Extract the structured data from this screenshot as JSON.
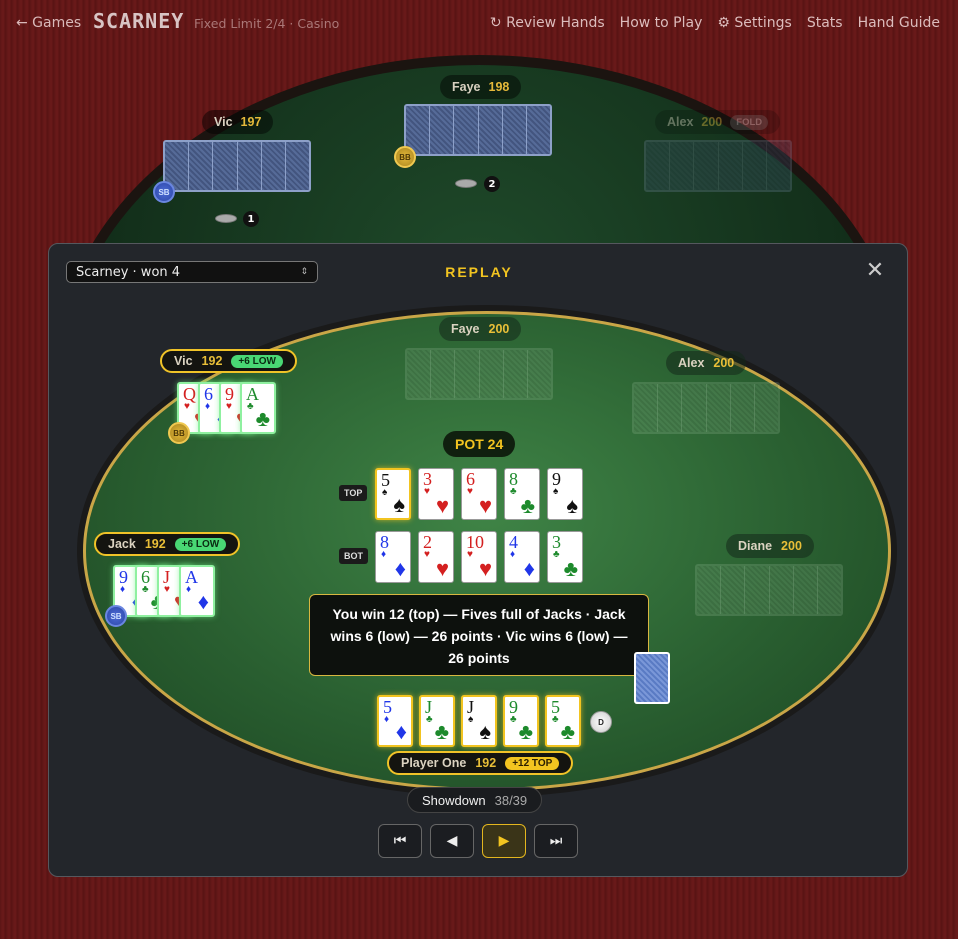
{
  "nav": {
    "back": "← Games",
    "brand": "SCARNEY",
    "subtitle": "Fixed Limit 2/4 · Casino",
    "links": [
      "↻ Review Hands",
      "How to Play",
      "⚙ Settings",
      "Stats",
      "Hand Guide"
    ]
  },
  "background_table": {
    "players": [
      {
        "name": "Vic",
        "stack": "197",
        "status": ""
      },
      {
        "name": "Faye",
        "stack": "198",
        "status": ""
      },
      {
        "name": "Alex",
        "stack": "200",
        "status": "FOLD"
      }
    ],
    "blinds": {
      "sb": "SB",
      "bb": "BB"
    },
    "bets": [
      "1",
      "2"
    ]
  },
  "replay": {
    "title": "REPLAY",
    "hand_select": "Scarney · won 4",
    "close": "✕",
    "pot": "POT 24",
    "row_labels": {
      "top": "TOP",
      "bot": "BOT"
    },
    "message": "You win 12 (top) — Fives full of Jacks · Jack wins 6 (low) — 26 points · Vic wins 6 (low) — 26 points",
    "status": {
      "label": "Showdown",
      "step": "38/39"
    },
    "controls": [
      "⏮",
      "◀",
      "▶",
      "⏭"
    ],
    "dealer": "D",
    "players": {
      "faye": {
        "name": "Faye",
        "stack": "200"
      },
      "alex": {
        "name": "Alex",
        "stack": "200"
      },
      "diane": {
        "name": "Diane",
        "stack": "200"
      },
      "vic": {
        "name": "Vic",
        "stack": "192",
        "delta": "+6 LOW",
        "blind": "BB"
      },
      "jack": {
        "name": "Jack",
        "stack": "192",
        "delta": "+6 LOW",
        "blind": "SB"
      },
      "hero": {
        "name": "Player One",
        "stack": "192",
        "delta": "+12 TOP"
      }
    },
    "cards": {
      "top": [
        {
          "rank": "5",
          "suit": "♠",
          "color": "black"
        },
        {
          "rank": "3",
          "suit": "♥",
          "color": "red"
        },
        {
          "rank": "6",
          "suit": "♥",
          "color": "red"
        },
        {
          "rank": "8",
          "suit": "♣",
          "color": "green"
        },
        {
          "rank": "9",
          "suit": "♠",
          "color": "black"
        }
      ],
      "bottom": [
        {
          "rank": "8",
          "suit": "♦",
          "color": "blue"
        },
        {
          "rank": "2",
          "suit": "♥",
          "color": "red"
        },
        {
          "rank": "10",
          "suit": "♥",
          "color": "red"
        },
        {
          "rank": "4",
          "suit": "♦",
          "color": "blue"
        },
        {
          "rank": "3",
          "suit": "♣",
          "color": "green"
        }
      ],
      "hero": [
        {
          "rank": "5",
          "suit": "♦",
          "color": "blue"
        },
        {
          "rank": "J",
          "suit": "♣",
          "color": "green"
        },
        {
          "rank": "J",
          "suit": "♠",
          "color": "black"
        },
        {
          "rank": "9",
          "suit": "♣",
          "color": "green"
        },
        {
          "rank": "5",
          "suit": "♣",
          "color": "green"
        }
      ],
      "vic": [
        {
          "rank": "Q",
          "suit": "♥",
          "color": "red"
        },
        {
          "rank": "6",
          "suit": "♦",
          "color": "blue"
        },
        {
          "rank": "9",
          "suit": "♥",
          "color": "red"
        },
        {
          "rank": "A",
          "suit": "♣",
          "color": "green"
        }
      ],
      "jack": [
        {
          "rank": "9",
          "suit": "♦",
          "color": "blue"
        },
        {
          "rank": "6",
          "suit": "♣",
          "color": "green"
        },
        {
          "rank": "J",
          "suit": "♥",
          "color": "red"
        },
        {
          "rank": "A",
          "suit": "♦",
          "color": "blue"
        }
      ]
    },
    "highlights": {
      "top_first": true
    }
  },
  "colors": {
    "accent": "#f2c420",
    "felt": "#2a6031",
    "win": "#49d774"
  }
}
